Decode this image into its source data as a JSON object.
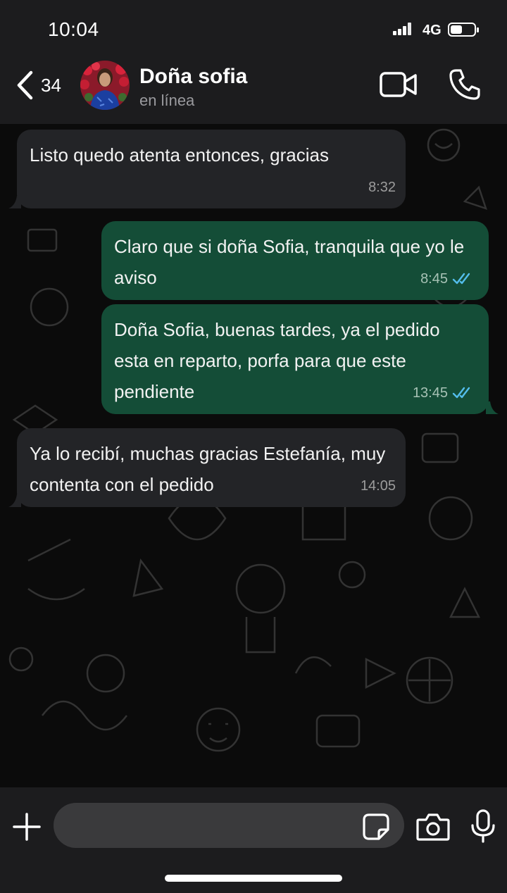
{
  "status_bar": {
    "time": "10:04",
    "network": "4G",
    "battery_level": 0.5
  },
  "header": {
    "back_count": "34",
    "contact_name": "Doña sofia",
    "contact_status": "en línea"
  },
  "messages": [
    {
      "direction": "incoming",
      "text": "Listo quedo atenta entonces, gracias",
      "time": "8:32"
    },
    {
      "direction": "outgoing",
      "text": "Claro que si doña Sofia, tranquila que yo le aviso",
      "time": "8:45",
      "status": "read"
    },
    {
      "direction": "outgoing",
      "text": "Doña Sofia, buenas tardes, ya el pedido esta en reparto, porfa para que este pendiente",
      "time": "13:45",
      "status": "read"
    },
    {
      "direction": "incoming",
      "text": "Ya lo recibí, muchas gracias Estefanía, muy contenta con el pedido",
      "time": "14:05"
    }
  ],
  "input": {
    "placeholder": "",
    "value": ""
  },
  "colors": {
    "incoming_bubble": "#232427",
    "outgoing_bubble": "#144d37",
    "read_ticks": "#53bdeb",
    "header_bg": "#1c1c1e"
  },
  "icons": [
    "back-chevron-icon",
    "video-camera-icon",
    "phone-icon",
    "plus-icon",
    "sticker-icon",
    "camera-icon",
    "microphone-icon"
  ]
}
